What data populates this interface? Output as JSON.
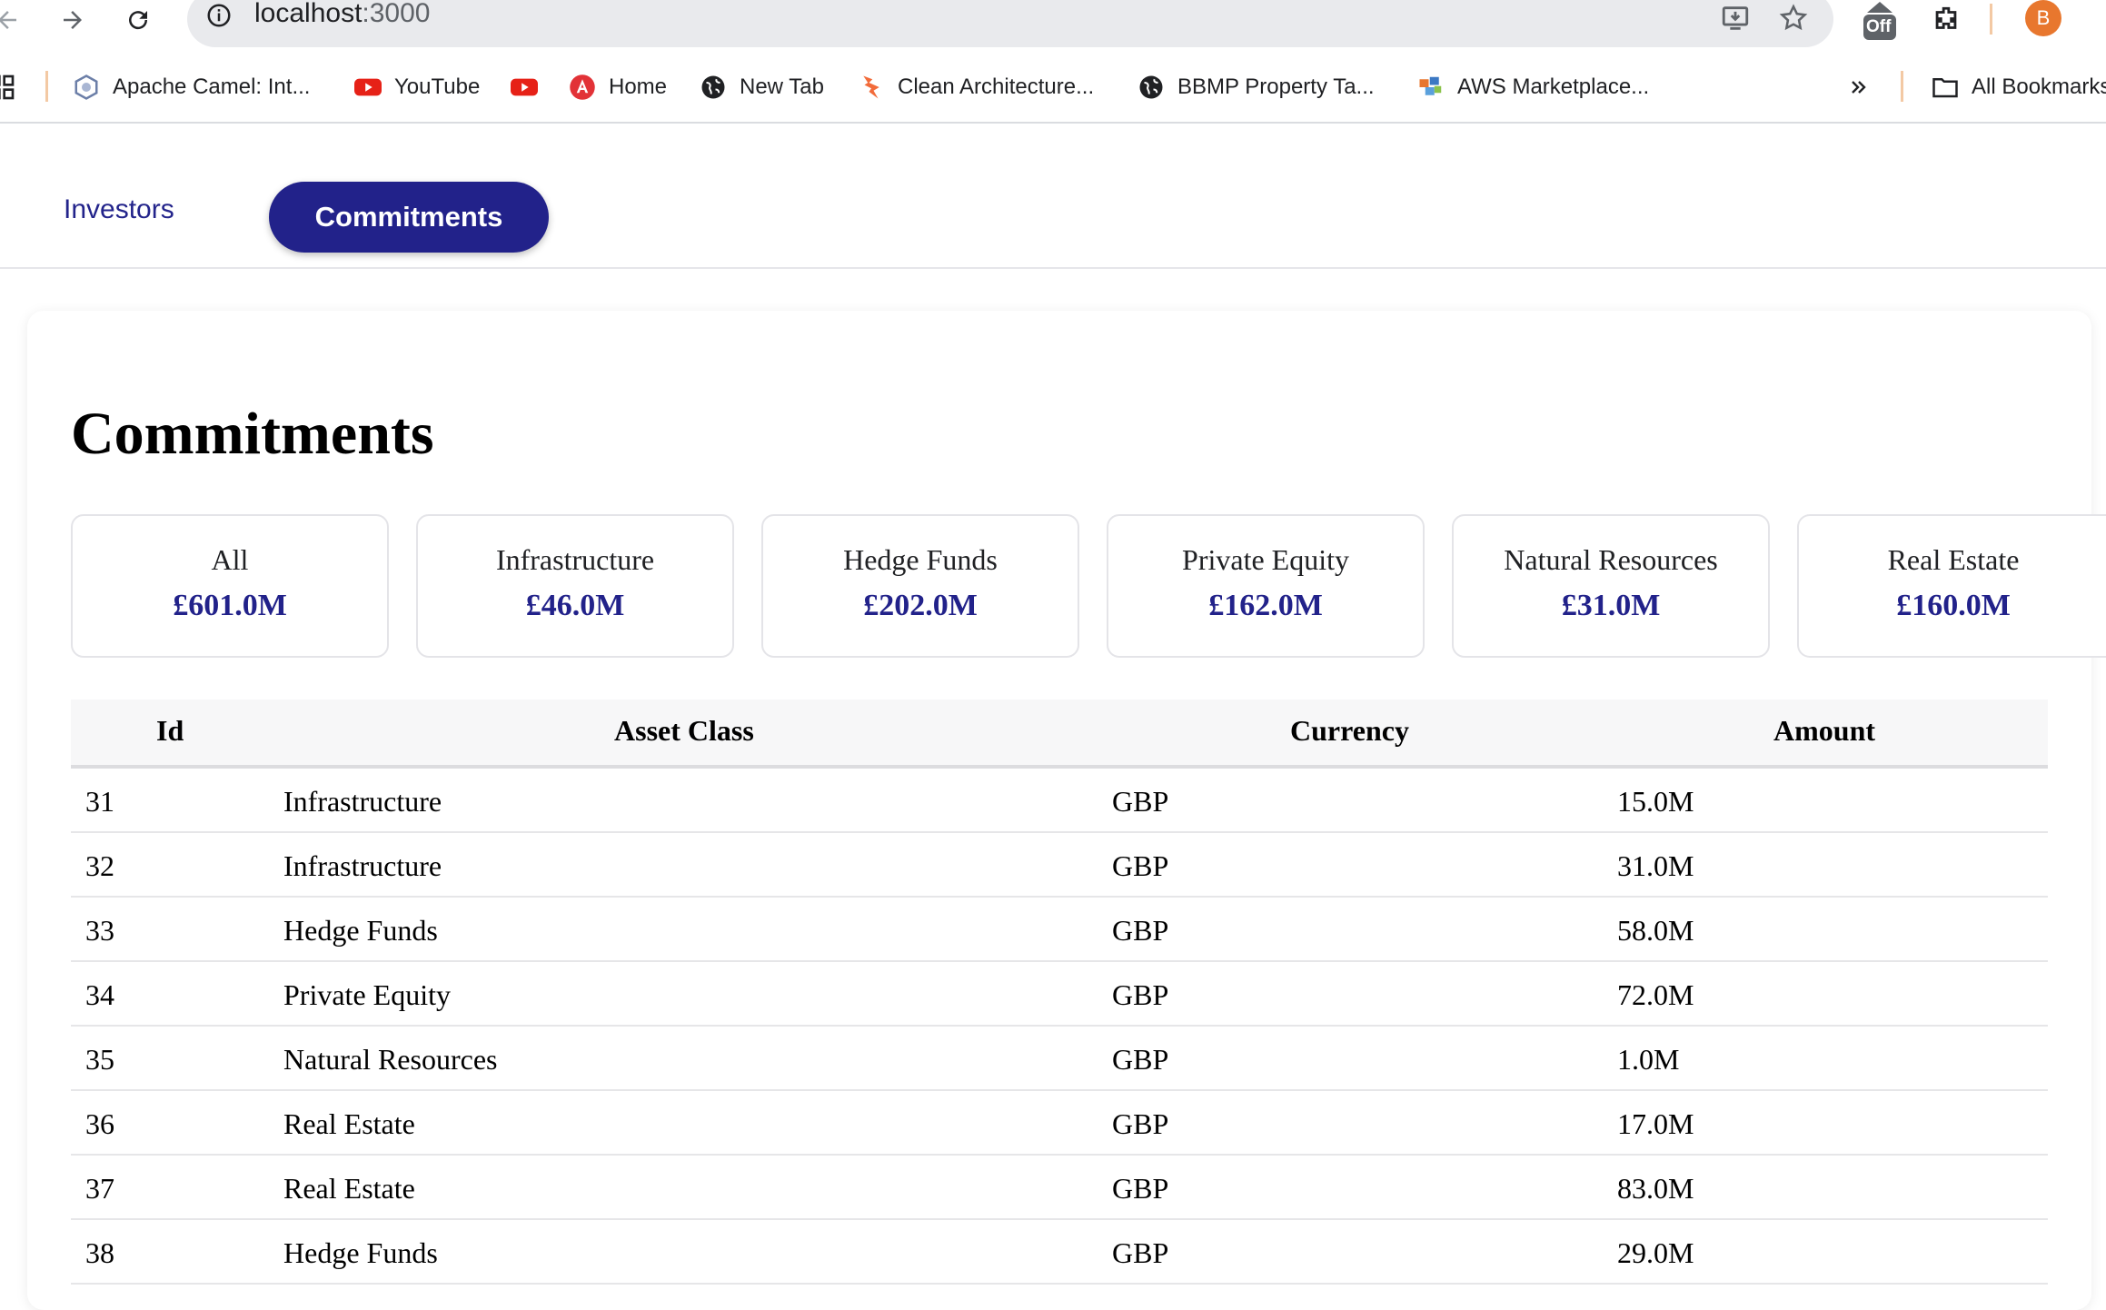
{
  "browser": {
    "url_host": "localhost",
    "url_port": ":3000",
    "profile_initial": "B",
    "extension_badge": "Off"
  },
  "bookmarks": [
    {
      "label": "Apache Camel: Int...",
      "icon": "camel-icon"
    },
    {
      "label": "YouTube",
      "icon": "youtube-icon"
    },
    {
      "label": "",
      "icon": "youtube-icon"
    },
    {
      "label": "Home",
      "icon": "angular-icon"
    },
    {
      "label": "New Tab",
      "icon": "globe-icon"
    },
    {
      "label": "Clean Architecture...",
      "icon": "bookmark-orange-icon"
    },
    {
      "label": "BBMP Property Ta...",
      "icon": "globe-icon"
    },
    {
      "label": "AWS Marketplace...",
      "icon": "aws-icon"
    }
  ],
  "bookmarks_all_label": "All Bookmarks",
  "app_tabs": {
    "investors": "Investors",
    "commitments": "Commitments"
  },
  "page_title": "Commitments",
  "filters": [
    {
      "label": "All",
      "value": "£601.0M"
    },
    {
      "label": "Infrastructure",
      "value": "£46.0M"
    },
    {
      "label": "Hedge Funds",
      "value": "£202.0M"
    },
    {
      "label": "Private Equity",
      "value": "£162.0M"
    },
    {
      "label": "Natural Resources",
      "value": "£31.0M"
    },
    {
      "label": "Real Estate",
      "value": "£160.0M"
    }
  ],
  "table": {
    "headers": [
      "Id",
      "Asset Class",
      "Currency",
      "Amount"
    ],
    "rows": [
      [
        "31",
        "Infrastructure",
        "GBP",
        "15.0M"
      ],
      [
        "32",
        "Infrastructure",
        "GBP",
        "31.0M"
      ],
      [
        "33",
        "Hedge Funds",
        "GBP",
        "58.0M"
      ],
      [
        "34",
        "Private Equity",
        "GBP",
        "72.0M"
      ],
      [
        "35",
        "Natural Resources",
        "GBP",
        "1.0M"
      ],
      [
        "36",
        "Real Estate",
        "GBP",
        "17.0M"
      ],
      [
        "37",
        "Real Estate",
        "GBP",
        "83.0M"
      ],
      [
        "38",
        "Hedge Funds",
        "GBP",
        "29.0M"
      ]
    ]
  },
  "colors": {
    "accent": "#22228a",
    "tab_text": "#23248b"
  }
}
